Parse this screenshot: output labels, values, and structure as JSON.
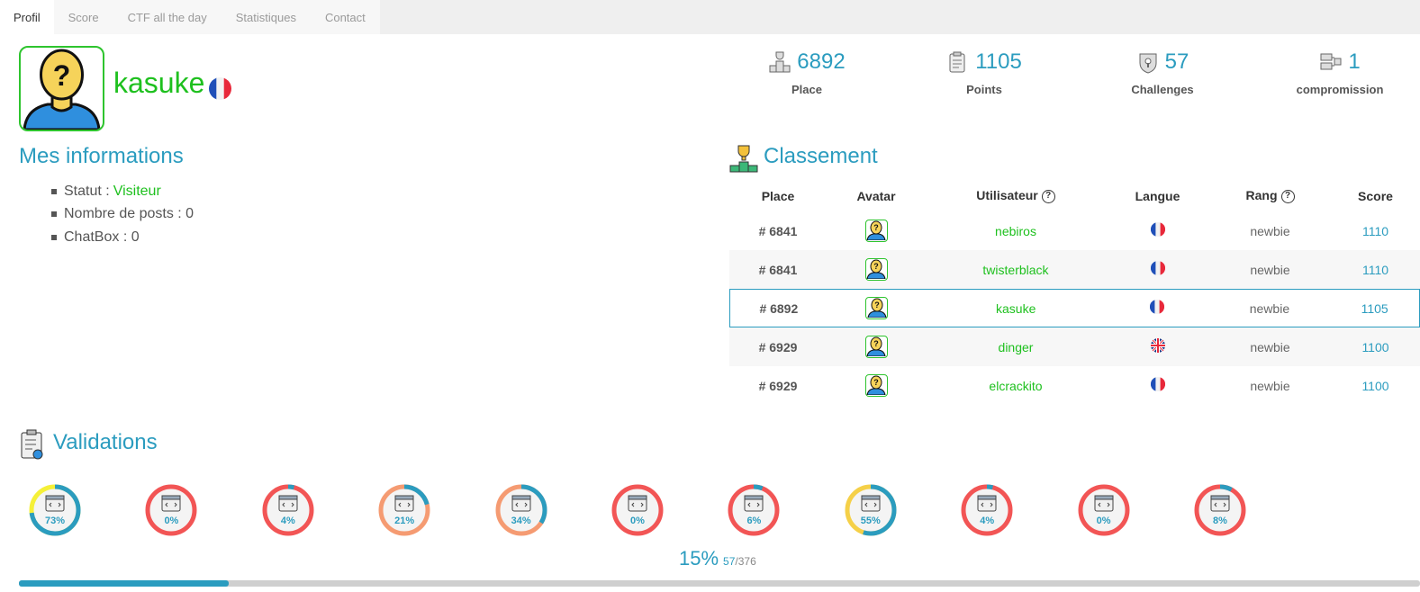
{
  "tabs": [
    {
      "label": "Profil",
      "active": true
    },
    {
      "label": "Score"
    },
    {
      "label": "CTF all the day"
    },
    {
      "label": "Statistiques"
    },
    {
      "label": "Contact"
    }
  ],
  "profile": {
    "username": "kasuke",
    "flag": "fr"
  },
  "stats": [
    {
      "value": "6892",
      "label": "Place",
      "icon": "podium-icon"
    },
    {
      "value": "1105",
      "label": "Points",
      "icon": "clipboard-icon"
    },
    {
      "value": "57",
      "label": "Challenges",
      "icon": "shield-icon"
    },
    {
      "value": "1",
      "label": "compromission",
      "icon": "network-icon"
    }
  ],
  "info": {
    "title": "Mes informations",
    "statut_label": "Statut :",
    "statut_value": "Visiteur",
    "posts": "Nombre de posts : 0",
    "chatbox": "ChatBox : 0"
  },
  "ranking": {
    "title": "Classement",
    "headers": {
      "place": "Place",
      "avatar": "Avatar",
      "user": "Utilisateur",
      "lang": "Langue",
      "rank": "Rang",
      "score": "Score"
    },
    "help_glyph": "?",
    "rows": [
      {
        "place": "# 6841",
        "user": "nebiros",
        "lang": "fr",
        "rank": "newbie",
        "score": "1110"
      },
      {
        "place": "# 6841",
        "user": "twisterblack",
        "lang": "fr",
        "rank": "newbie",
        "score": "1110"
      },
      {
        "place": "# 6892",
        "user": "kasuke",
        "lang": "fr",
        "rank": "newbie",
        "score": "1105",
        "me": true
      },
      {
        "place": "# 6929",
        "user": "dinger",
        "lang": "gb",
        "rank": "newbie",
        "score": "1100"
      },
      {
        "place": "# 6929",
        "user": "elcrackito",
        "lang": "fr",
        "rank": "newbie",
        "score": "1100"
      }
    ]
  },
  "validations": {
    "title": "Validations",
    "gauges": [
      {
        "pct": 73,
        "label": "73%",
        "color": "#f5f038",
        "icon": "web-client-icon"
      },
      {
        "pct": 0,
        "label": "0%",
        "color": "#f25555",
        "icon": "web-server-icon"
      },
      {
        "pct": 4,
        "label": "4%",
        "color": "#f25555",
        "icon": "cryptanalysis-icon"
      },
      {
        "pct": 21,
        "label": "21%",
        "color": "#f59b72",
        "icon": "steganography-icon"
      },
      {
        "pct": 34,
        "label": "34%",
        "color": "#f59b72",
        "icon": "cloud-network-icon"
      },
      {
        "pct": 0,
        "label": "0%",
        "color": "#f25555",
        "icon": "monitor-icon"
      },
      {
        "pct": 6,
        "label": "6%",
        "color": "#f25555",
        "icon": "server-icon"
      },
      {
        "pct": 55,
        "label": "55%",
        "color": "#f5d048",
        "icon": "network-hub-icon"
      },
      {
        "pct": 4,
        "label": "4%",
        "color": "#f25555",
        "icon": "terminal-icon"
      },
      {
        "pct": 0,
        "label": "0%",
        "color": "#f25555",
        "icon": "binary-icon"
      },
      {
        "pct": 8,
        "label": "8%",
        "color": "#f25555",
        "icon": "forensic-icon"
      }
    ],
    "total_pct": "15%",
    "total_done": "57",
    "total_of": "/376",
    "progress": 0.15
  },
  "colors": {
    "accent": "#2b9cbf",
    "green": "#1ec01e"
  }
}
